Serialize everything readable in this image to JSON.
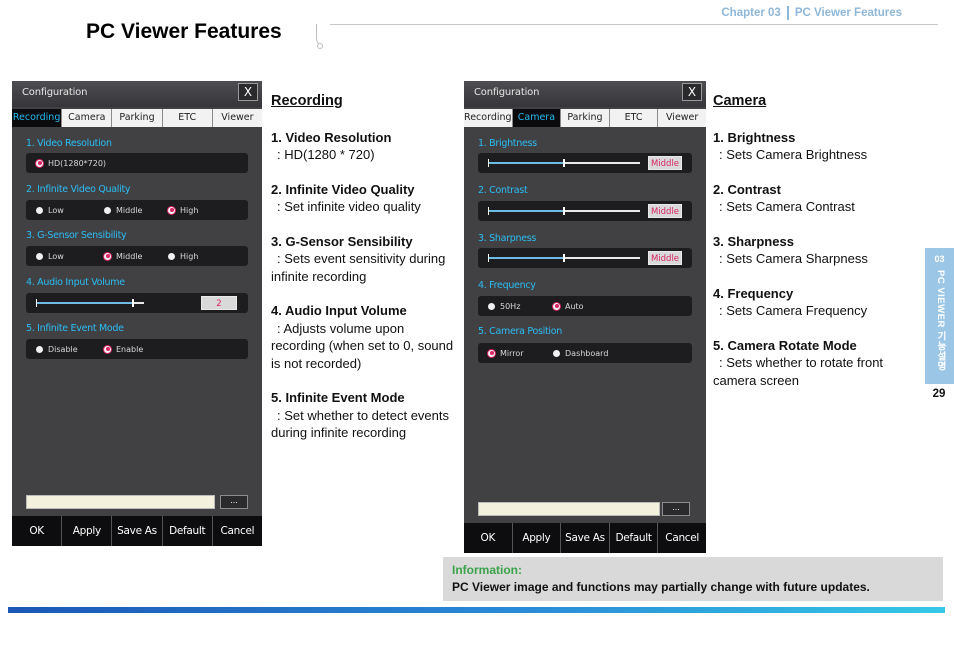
{
  "header": {
    "chapter": "Chapter 03",
    "section": "PC Viewer Features",
    "title": "PC Viewer Features"
  },
  "dialog_recording": {
    "title": "Configuration",
    "close": "X",
    "tabs": [
      "Recording",
      "Camera",
      "Parking",
      "ETC",
      "Viewer"
    ],
    "active_tab": "Recording",
    "sections": {
      "s1": {
        "label": "1. Video Resolution",
        "options": [
          "HD(1280*720)"
        ]
      },
      "s2": {
        "label": "2. Infinite Video Quality",
        "options": [
          "Low",
          "Middle",
          "High"
        ]
      },
      "s3": {
        "label": "3. G-Sensor Sensibility",
        "options": [
          "Low",
          "Middle",
          "High"
        ]
      },
      "s4": {
        "label": "4. Audio Input Volume",
        "value": "2",
        "level": 0.9
      },
      "s5": {
        "label": "5. Infinite Event Mode",
        "options": [
          "Disable",
          "Enable"
        ]
      }
    },
    "selected": {
      "s1": "HD(1280*720)",
      "s2": "High",
      "s3": "Middle",
      "s5": "Enable"
    },
    "browse": "...",
    "footer": [
      "OK",
      "Apply",
      "Save As",
      "Default",
      "Cancel"
    ]
  },
  "dialog_camera": {
    "title": "Configuration",
    "close": "X",
    "tabs": [
      "Recording",
      "Camera",
      "Parking",
      "ETC",
      "Viewer"
    ],
    "active_tab": "Camera",
    "sections": {
      "s1": {
        "label": "1. Brightness",
        "value": "Middle",
        "level": 0.5
      },
      "s2": {
        "label": "2. Contrast",
        "value": "Middle",
        "level": 0.5
      },
      "s3": {
        "label": "3. Sharpness",
        "value": "Middle",
        "level": 0.5
      },
      "s4": {
        "label": "4. Frequency",
        "options": [
          "50Hz",
          "Auto"
        ]
      },
      "s5": {
        "label": "5. Camera Position",
        "options": [
          "Mirror",
          "Dashboard"
        ]
      }
    },
    "selected": {
      "s4": "Auto",
      "s5": "Mirror"
    },
    "browse": "...",
    "footer": [
      "OK",
      "Apply",
      "Save As",
      "Default",
      "Cancel"
    ]
  },
  "recording_desc": {
    "heading": "Recording",
    "items": [
      {
        "title": "1. Video Resolution",
        "text": ": HD(1280 * 720)"
      },
      {
        "title": "2. Infinite Video Quality",
        "text": ": Set infinite video quality"
      },
      {
        "title": "3. G-Sensor Sensibility",
        "text": ": Sets event sensitivity during infinite recording"
      },
      {
        "title": "4. Audio Input Volume",
        "text": ": Adjusts volume upon recording (when set to 0, sound is not recorded)"
      },
      {
        "title": "5. Infinite Event Mode",
        "text": ": Set whether to detect events during infinite recording"
      }
    ]
  },
  "camera_desc": {
    "heading": "Camera",
    "items": [
      {
        "title": "1. Brightness",
        "text": ": Sets Camera Brightness"
      },
      {
        "title": "2. Contrast",
        "text": ": Sets Camera Contrast"
      },
      {
        "title": "3. Sharpness",
        "text": ": Sets Camera Sharpness"
      },
      {
        "title": "4. Frequency",
        "text": ": Sets Camera Frequency"
      },
      {
        "title": "5. Camera Rotate Mode",
        "text": ": Sets whether to rotate front camera screen"
      }
    ]
  },
  "side_tab": {
    "number": "03",
    "label": "PC VIEWER 기능설명"
  },
  "page_number": "29",
  "info": {
    "label": "Information:",
    "text": "PC Viewer image and functions may partially change with future updates."
  },
  "colors": {
    "accent_blue": "#2bbdf3",
    "selected_pink": "#d82364",
    "info_green": "#3aa34a",
    "side_tab": "#9cc6e6"
  }
}
